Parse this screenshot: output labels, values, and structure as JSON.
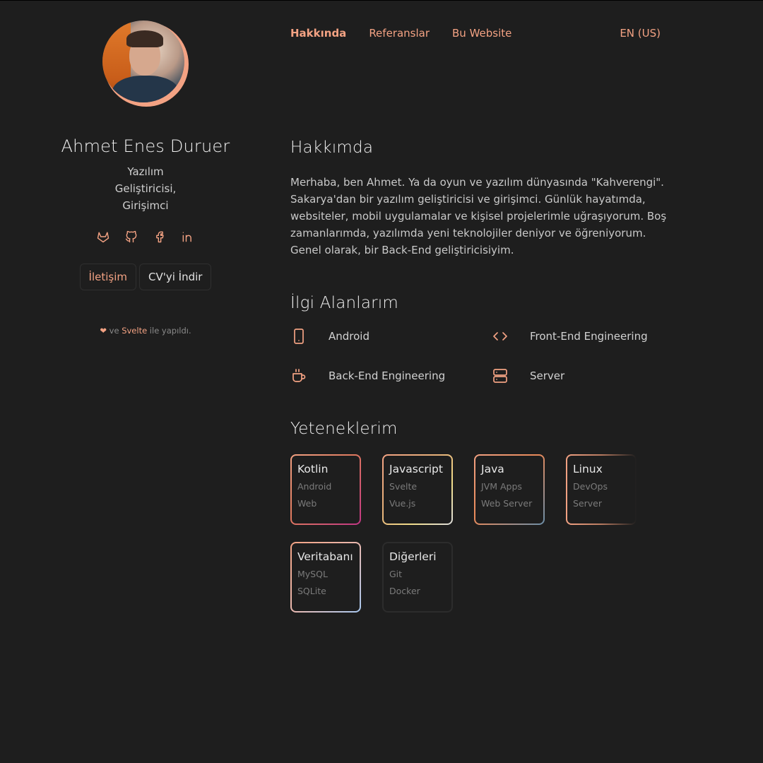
{
  "sidebar": {
    "name": "Ahmet Enes Duruer",
    "title_line1": "Yazılım Geliştiricisi,",
    "title_line2": "Girişimci",
    "socials": [
      "gitlab-icon",
      "github-icon",
      "facebook-icon",
      "linkedin-icon"
    ],
    "contact_label": "İletişim",
    "cv_label": "CV'yi İndir",
    "made_with_heart": "❤",
    "made_with_ve": " ve ",
    "made_with_svelte": "Svelte",
    "made_with_suffix": " ile yapıldı."
  },
  "nav": {
    "items": [
      "Hakkında",
      "Referanslar",
      "Bu Website"
    ],
    "language": "EN (US)"
  },
  "about": {
    "heading": "Hakkımda",
    "text": "Merhaba, ben Ahmet. Ya da oyun ve yazılım dünyasında \"Kahverengi\". Sakarya'dan bir yazılım geliştiricisi ve girişimci. Günlük hayatımda, websiteler, mobil uygulamalar ve kişisel projelerimle uğraşıyorum. Boş zamanlarımda, yazılımda yeni teknolojiler deniyor ve öğreniyorum. Genel olarak, bir Back-End geliştiricisiyim."
  },
  "interests": {
    "heading": "İlgi Alanlarım",
    "items": [
      {
        "icon": "phone-icon",
        "label": "Android"
      },
      {
        "icon": "code-icon",
        "label": "Front-End Engineering"
      },
      {
        "icon": "coffee-icon",
        "label": "Back-End Engineering"
      },
      {
        "icon": "server-icon",
        "label": "Server"
      }
    ]
  },
  "skills": {
    "heading": "Yeteneklerim",
    "items": [
      {
        "title": "Kotlin",
        "sub1": "Android",
        "sub2": "Web"
      },
      {
        "title": "Javascript",
        "sub1": "Svelte",
        "sub2": "Vue.js"
      },
      {
        "title": "Java",
        "sub1": "JVM Apps",
        "sub2": "Web Server"
      },
      {
        "title": "Linux",
        "sub1": "DevOps",
        "sub2": "Server"
      },
      {
        "title": "Veritabanı",
        "sub1": "MySQL",
        "sub2": "SQLite"
      },
      {
        "title": "Diğerleri",
        "sub1": "Git",
        "sub2": "Docker"
      }
    ]
  },
  "colors": {
    "accent": "#f3a283",
    "background": "#1e1e1e"
  }
}
